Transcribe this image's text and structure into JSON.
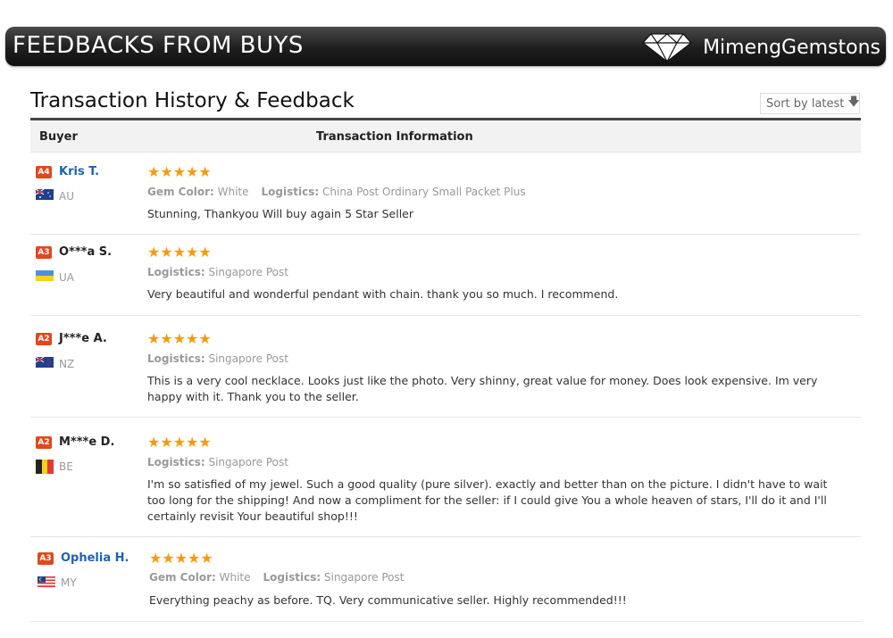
{
  "banner": {
    "title": "FEEDBACKS FROM BUYS",
    "brand": "MimengGemstons"
  },
  "section": {
    "title": "Transaction History & Feedback",
    "sort_label": "Sort by latest"
  },
  "table": {
    "col_buyer": "Buyer",
    "col_info": "Transaction Information"
  },
  "reviews": [
    {
      "level": "A4",
      "name": "Kris T.",
      "country": "AU",
      "stars": "★★★★★",
      "rating": 5,
      "gem_label": "Gem Color:",
      "gem_value": "White",
      "logistics_label": "Logistics:",
      "logistics_value": "China Post Ordinary Small Packet Plus",
      "comment": "Stunning, Thankyou Will buy again 5 Star Seller"
    },
    {
      "level": "A3",
      "name": "O***a S.",
      "country": "UA",
      "stars": "★★★★★",
      "rating": 5,
      "logistics_label": "Logistics:",
      "logistics_value": "Singapore Post",
      "comment": "Very beautiful and wonderful pendant with chain. thank you so much. I recommend."
    },
    {
      "level": "A2",
      "name": "J***e A.",
      "country": "NZ",
      "stars": "★★★★★",
      "rating": 5,
      "logistics_label": "Logistics:",
      "logistics_value": "Singapore Post",
      "comment": "This is a very cool necklace. Looks just like the photo. Very shinny, great value for money. Does look expensive. Im very happy with it. Thank you to the seller."
    },
    {
      "level": "A2",
      "name": "M***e D.",
      "country": "BE",
      "stars": "★★★★★",
      "rating": 5,
      "logistics_label": "Logistics:",
      "logistics_value": "Singapore Post",
      "comment": "I'm so satisfied of my jewel. Such a good quality (pure silver). exactly and better than on the picture. I didn't have to wait too long for the shipping! And now a compliment for the seller: if I could give You a whole heaven of stars, I'll do it and I'll certainly revisit Your beautiful shop!!!"
    },
    {
      "level": "A3",
      "name": "Ophelia H.",
      "country": "MY",
      "stars": "★★★★★",
      "rating": 5,
      "gem_label": "Gem Color:",
      "gem_value": "White",
      "logistics_label": "Logistics:",
      "logistics_value": "Singapore Post",
      "comment": "Everything peachy as before. TQ. Very communicative seller. Highly recommended!!!"
    }
  ],
  "colors": {
    "badge": "#e2471c",
    "star": "#f29c0f",
    "link": "#1d63b5"
  }
}
